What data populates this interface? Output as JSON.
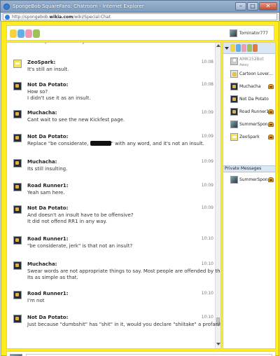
{
  "window": {
    "title": "SpongeBob SquareFans: Chatroom - Internet Explorer",
    "url_prefix": "http://spongebob.",
    "url_domain": "wikia.com",
    "url_path": "/wiki/Special:Chat",
    "btn_min": "–",
    "btn_max": "□",
    "btn_close": "✕"
  },
  "header": {
    "username": "Tominator777"
  },
  "messages": [
    {
      "user": "",
      "time": "",
      "avatar": "sponge",
      "lines": [
        "Good upload them on your wiki."
      ]
    },
    {
      "user": "ZeoSpark:",
      "time": "10:08",
      "avatar": "sponge",
      "lines": [
        "It's still an insult."
      ]
    },
    {
      "user": "Not Da Potato:",
      "time": "10:08",
      "avatar": "dark",
      "lines": [
        "How so?",
        "I didn't use it as an insult."
      ]
    },
    {
      "user": "Muchacha:",
      "time": "10:09",
      "avatar": "dark",
      "lines": [
        "Cant wait to see the new Kickfest page."
      ]
    },
    {
      "user": "Not Da Potato:",
      "time": "10:09",
      "avatar": "dark",
      "lines_pre": "Replace \"be considerate, ",
      "lines_post": "\" with any word, and it's not an insult."
    },
    {
      "user": "Muchacha:",
      "time": "10:09",
      "avatar": "dark",
      "lines": [
        "Its still insulting."
      ]
    },
    {
      "user": "Road Runner1:",
      "time": "10:09",
      "avatar": "dark",
      "lines": [
        "Yeah sam here."
      ]
    },
    {
      "user": "Not Da Potato:",
      "time": "10:09",
      "avatar": "dark",
      "lines": [
        "And doesn't an insult have to be offensive?",
        "It did not offend RR1 in any way."
      ]
    },
    {
      "user": "Road Runner1:",
      "time": "10:10",
      "avatar": "dark",
      "lines": [
        "\"be considerate, jerk\" is that not an insult?"
      ]
    },
    {
      "user": "Muchacha:",
      "time": "10:10",
      "avatar": "dark",
      "lines": [
        "Swear words are not appropriate things to say. Most people are offended by them.",
        "Its as simple as that."
      ]
    },
    {
      "user": "Road Runner1:",
      "time": "10:10",
      "avatar": "dark",
      "lines": [
        "I'm not"
      ]
    },
    {
      "user": "Not Da Potato:",
      "time": "10:10",
      "avatar": "dark",
      "lines": [
        "Just because \"dumbshit\" has \"shit\" in it, would you declare \"shiitake\" a profanity?"
      ]
    }
  ],
  "users": [
    {
      "name": "AMK152Bot",
      "status": "Away",
      "avatar": "grey",
      "mod": false,
      "away": true
    },
    {
      "name": "Cartoon Lover...",
      "status": "",
      "avatar": "spongeAlt",
      "mod": false,
      "away": false
    },
    {
      "name": "Muchacha",
      "status": "",
      "avatar": "dark",
      "mod": true,
      "away": false
    },
    {
      "name": "Not Da Potato",
      "status": "",
      "avatar": "dark",
      "mod": false,
      "away": false
    },
    {
      "name": "Road Runner1",
      "status": "",
      "avatar": "dark",
      "mod": true,
      "away": false
    },
    {
      "name": "SummerSpon...",
      "status": "",
      "avatar": "photo",
      "mod": true,
      "away": false
    },
    {
      "name": "ZeoSpark",
      "status": "",
      "avatar": "sponge",
      "mod": true,
      "away": false
    }
  ],
  "private_messages": {
    "label": "Private Messages",
    "users": [
      {
        "name": "SummerSpon...",
        "avatar": "photo",
        "mod": true
      }
    ]
  },
  "composer": {
    "placeholder": ""
  },
  "colors": {
    "frame": "#ffec1f",
    "accent": "#dbe6f4"
  }
}
